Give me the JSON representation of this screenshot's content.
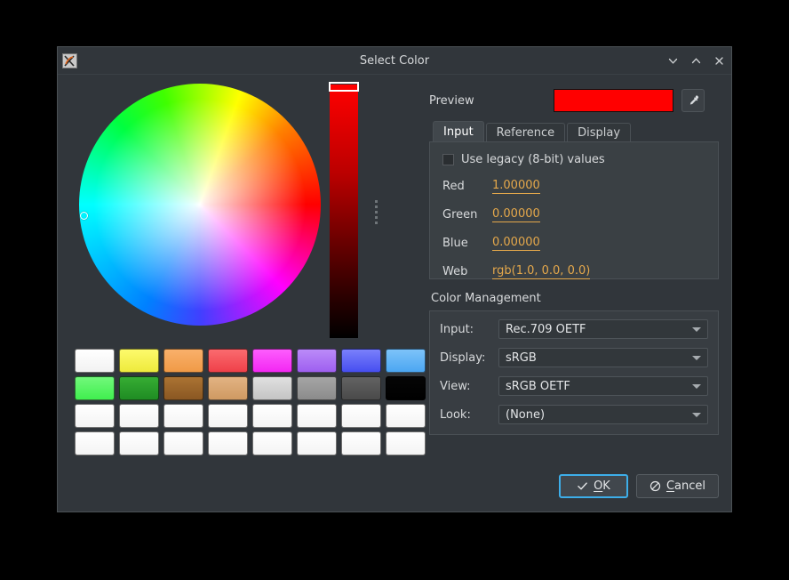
{
  "window": {
    "title": "Select Color",
    "app_icon": "app-logo-icon",
    "minimize_icon": "chevron-down-icon",
    "maximize_icon": "chevron-up-icon",
    "close_icon": "close-icon"
  },
  "color_wheel": {
    "name": "color-wheel",
    "marker": "wheel-selector-marker"
  },
  "value_slider": {
    "name": "value-slider",
    "handle": "value-slider-handle"
  },
  "splitter": {
    "name": "panel-splitter"
  },
  "palette": {
    "rows": [
      [
        {
          "name": "swatch-white",
          "color": "#fcfcfc",
          "grad_top": "#ffffff",
          "grad_bottom": "#f2f2f2"
        },
        {
          "name": "swatch-yellow",
          "color": "#f6f151",
          "grad_top": "#fdfa6c",
          "grad_bottom": "#eeea3c"
        },
        {
          "name": "swatch-orange",
          "color": "#f5a košy",
          "grad_top": "#f9b06b",
          "grad_bottom": "#f09a46"
        },
        {
          "name": "swatch-red",
          "color": "#f4555c",
          "grad_top": "#fa6b6f",
          "grad_bottom": "#ef4049"
        },
        {
          "name": "swatch-magenta",
          "color": "#f93ef9",
          "grad_top": "#fd5dfd",
          "grad_bottom": "#f327f3"
        },
        {
          "name": "swatch-purple",
          "color": "#ac74f2",
          "grad_top": "#bb8bf8",
          "grad_bottom": "#9e5ff0"
        },
        {
          "name": "swatch-blue",
          "color": "#5b63f3",
          "grad_top": "#7a80fb",
          "grad_bottom": "#464ef0"
        },
        {
          "name": "swatch-light-blue",
          "color": "#62b4f5",
          "grad_top": "#7dc3f9",
          "grad_bottom": "#4ba6f2"
        }
      ],
      [
        {
          "name": "swatch-light-green",
          "color": "#57f263",
          "grad_top": "#72f87b",
          "grad_bottom": "#40ef4f"
        },
        {
          "name": "swatch-green",
          "color": "#2a9c2a",
          "grad_top": "#36ad33",
          "grad_bottom": "#1f8c23"
        },
        {
          "name": "swatch-brown",
          "color": "#9a642a",
          "grad_top": "#ab7333",
          "grad_bottom": "#8a5722"
        },
        {
          "name": "swatch-tan",
          "color": "#d9a672",
          "grad_top": "#e2b383",
          "grad_bottom": "#cf9a62"
        },
        {
          "name": "swatch-light-gray",
          "color": "#d2d2d2",
          "grad_top": "#e0e0e0",
          "grad_bottom": "#c4c4c4"
        },
        {
          "name": "swatch-gray",
          "color": "#989898",
          "grad_top": "#a5a5a5",
          "grad_bottom": "#8b8b8b"
        },
        {
          "name": "swatch-dark-gray",
          "color": "#565656",
          "grad_top": "#636363",
          "grad_bottom": "#4a4a4a"
        },
        {
          "name": "swatch-black",
          "color": "#000000",
          "grad_top": "#050505",
          "grad_bottom": "#000000"
        }
      ],
      [
        {
          "name": "swatch-empty",
          "color": "#fbfbfb",
          "grad_top": "#ffffff",
          "grad_bottom": "#f4f4f4"
        },
        {
          "name": "swatch-empty",
          "color": "#fbfbfb",
          "grad_top": "#ffffff",
          "grad_bottom": "#f4f4f4"
        },
        {
          "name": "swatch-empty",
          "color": "#fbfbfb",
          "grad_top": "#ffffff",
          "grad_bottom": "#f4f4f4"
        },
        {
          "name": "swatch-empty",
          "color": "#fbfbfb",
          "grad_top": "#ffffff",
          "grad_bottom": "#f4f4f4"
        },
        {
          "name": "swatch-empty",
          "color": "#fbfbfb",
          "grad_top": "#ffffff",
          "grad_bottom": "#f4f4f4"
        },
        {
          "name": "swatch-empty",
          "color": "#fbfbfb",
          "grad_top": "#ffffff",
          "grad_bottom": "#f4f4f4"
        },
        {
          "name": "swatch-empty",
          "color": "#fbfbfb",
          "grad_top": "#ffffff",
          "grad_bottom": "#f4f4f4"
        },
        {
          "name": "swatch-empty",
          "color": "#fbfbfb",
          "grad_top": "#ffffff",
          "grad_bottom": "#f4f4f4"
        }
      ],
      [
        {
          "name": "swatch-empty",
          "color": "#fbfbfb",
          "grad_top": "#ffffff",
          "grad_bottom": "#f4f4f4"
        },
        {
          "name": "swatch-empty",
          "color": "#fbfbfb",
          "grad_top": "#ffffff",
          "grad_bottom": "#f4f4f4"
        },
        {
          "name": "swatch-empty",
          "color": "#fbfbfb",
          "grad_top": "#ffffff",
          "grad_bottom": "#f4f4f4"
        },
        {
          "name": "swatch-empty",
          "color": "#fbfbfb",
          "grad_top": "#ffffff",
          "grad_bottom": "#f4f4f4"
        },
        {
          "name": "swatch-empty",
          "color": "#fbfbfb",
          "grad_top": "#ffffff",
          "grad_bottom": "#f4f4f4"
        },
        {
          "name": "swatch-empty",
          "color": "#fbfbfb",
          "grad_top": "#ffffff",
          "grad_bottom": "#f4f4f4"
        },
        {
          "name": "swatch-empty",
          "color": "#fbfbfb",
          "grad_top": "#ffffff",
          "grad_bottom": "#f4f4f4"
        },
        {
          "name": "swatch-empty",
          "color": "#fbfbfb",
          "grad_top": "#ffffff",
          "grad_bottom": "#f4f4f4"
        }
      ]
    ]
  },
  "preview": {
    "label": "Preview",
    "color": "#ff0000",
    "picker_icon": "eyedropper-icon"
  },
  "tabs": [
    {
      "label": "Input",
      "active": true
    },
    {
      "label": "Reference",
      "active": false
    },
    {
      "label": "Display",
      "active": false
    }
  ],
  "input_tab": {
    "legacy_checkbox": {
      "label": "Use legacy (8-bit) values",
      "checked": false
    },
    "fields": [
      {
        "label": "Red",
        "value": "1.00000"
      },
      {
        "label": "Green",
        "value": "0.00000"
      },
      {
        "label": "Blue",
        "value": "0.00000"
      },
      {
        "label": "Web",
        "value": "rgb(1.0, 0.0, 0.0)"
      }
    ]
  },
  "color_management": {
    "title": "Color Management",
    "rows": [
      {
        "label": "Input:",
        "value": "Rec.709 OETF"
      },
      {
        "label": "Display:",
        "value": "sRGB"
      },
      {
        "label": "View:",
        "value": "sRGB OETF"
      },
      {
        "label": "Look:",
        "value": "(None)"
      }
    ]
  },
  "footer": {
    "ok": {
      "label": "OK",
      "underline_index": 0,
      "icon": "check-icon",
      "focused": true
    },
    "cancel": {
      "label": "Cancel",
      "underline_index": 0,
      "icon": "no-entry-icon",
      "focused": false
    }
  },
  "colors": {
    "accent": "#3daee9",
    "value_text": "#e5a84b",
    "dialog_bg": "#31363b"
  }
}
